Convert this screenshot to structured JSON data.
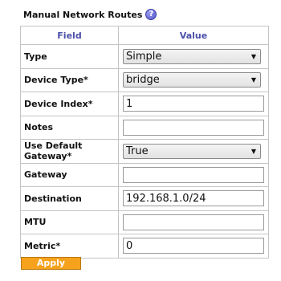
{
  "section": {
    "title": "Manual Network Routes",
    "help_icon": "question-mark-icon",
    "help_glyph": "?"
  },
  "table": {
    "headers": [
      "Field",
      "Value"
    ],
    "rows": [
      {
        "label": "Type",
        "kind": "select",
        "value": "Simple"
      },
      {
        "label": "Device Type*",
        "kind": "select",
        "value": "bridge"
      },
      {
        "label": "Device Index*",
        "kind": "input",
        "value": "1"
      },
      {
        "label": "Notes",
        "kind": "input",
        "value": ""
      },
      {
        "label": "Use Default Gateway*",
        "kind": "select",
        "value": "True"
      },
      {
        "label": "Gateway",
        "kind": "input",
        "value": ""
      },
      {
        "label": "Destination",
        "kind": "input",
        "value": "192.168.1.0/24"
      },
      {
        "label": "MTU",
        "kind": "input",
        "value": ""
      },
      {
        "label": "Metric*",
        "kind": "input",
        "value": "0"
      }
    ]
  },
  "actions": {
    "apply_label": "Apply"
  },
  "colors": {
    "header_text": "#4a4fa8",
    "apply_button_bg": "#f7a21c",
    "border": "#c4c4c4"
  }
}
